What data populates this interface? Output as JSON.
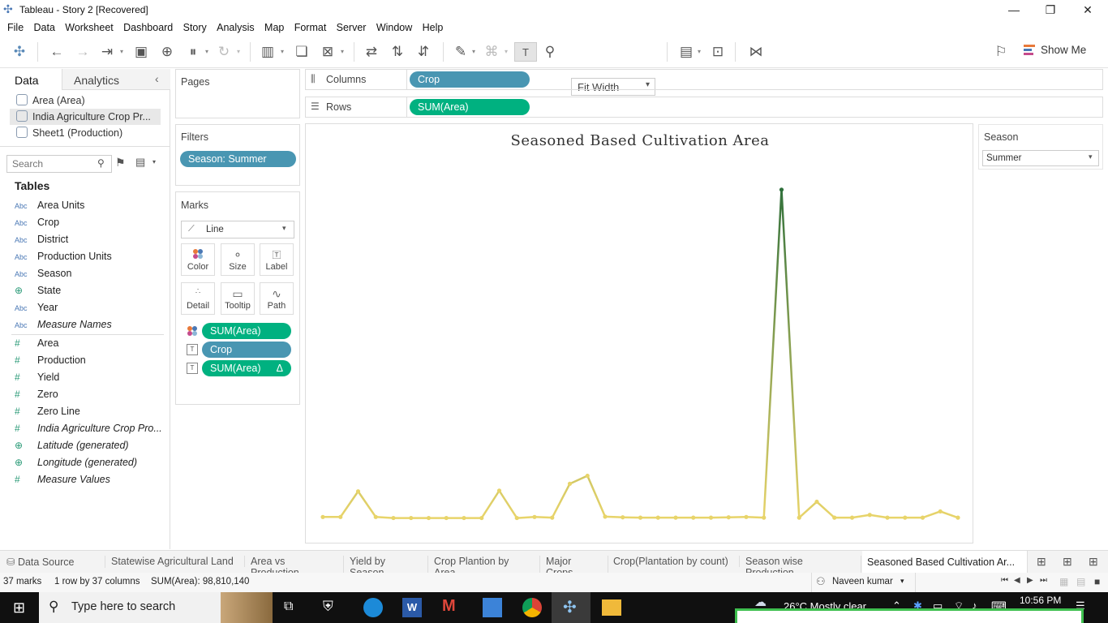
{
  "window": {
    "title": "Tableau - Story 2 [Recovered]"
  },
  "menu": [
    "File",
    "Data",
    "Worksheet",
    "Dashboard",
    "Story",
    "Analysis",
    "Map",
    "Format",
    "Server",
    "Window",
    "Help"
  ],
  "toolbar": {
    "fit_label": "Fit Width",
    "show_me_label": "Show Me"
  },
  "left_panel": {
    "tab_data": "Data",
    "tab_analytics": "Analytics",
    "data_sources": [
      "Area (Area)",
      "India Agriculture Crop Pr...",
      "Sheet1 (Production)"
    ],
    "search_placeholder": "Search",
    "tables_heading": "Tables",
    "dimensions": [
      {
        "type": "Abc",
        "name": "Area Units"
      },
      {
        "type": "Abc",
        "name": "Crop"
      },
      {
        "type": "Abc",
        "name": "District"
      },
      {
        "type": "Abc",
        "name": "Production Units"
      },
      {
        "type": "Abc",
        "name": "Season"
      },
      {
        "type": "globe",
        "name": "State"
      },
      {
        "type": "Abc",
        "name": "Year"
      },
      {
        "type": "Abc",
        "name": "Measure Names"
      }
    ],
    "measures": [
      {
        "type": "#",
        "name": "Area"
      },
      {
        "type": "#",
        "name": "Production"
      },
      {
        "type": "#",
        "name": "Yield"
      },
      {
        "type": "#",
        "name": "Zero"
      },
      {
        "type": "#",
        "name": "Zero Line"
      },
      {
        "type": "#",
        "name": "India Agriculture Crop Pro..."
      },
      {
        "type": "globe",
        "name": "Latitude (generated)"
      },
      {
        "type": "globe",
        "name": "Longitude (generated)"
      },
      {
        "type": "#",
        "name": "Measure Values"
      }
    ]
  },
  "pages": {
    "title": "Pages"
  },
  "filters": {
    "title": "Filters",
    "pill": "Season: Summer"
  },
  "marks": {
    "title": "Marks",
    "type": "Line",
    "buttons": [
      "Color",
      "Size",
      "Label",
      "Detail",
      "Tooltip",
      "Path"
    ],
    "pills": [
      "SUM(Area)",
      "Crop",
      "SUM(Area)"
    ],
    "delta_symbol": "Δ"
  },
  "shelves": {
    "columns_label": "Columns",
    "columns_pill": "Crop",
    "rows_label": "Rows",
    "rows_pill": "SUM(Area)"
  },
  "season_filter": {
    "title": "Season",
    "value": "Summer"
  },
  "chart_data": {
    "type": "line",
    "title": "Seasoned Based Cultivation Area",
    "xlabel": "",
    "ylabel": "",
    "grid": false,
    "values": [
      400,
      400,
      7800,
      400,
      100,
      100,
      100,
      100,
      100,
      100,
      8000,
      100,
      400,
      200,
      10000,
      12300,
      500,
      300,
      200,
      200,
      200,
      200,
      200,
      300,
      400,
      200,
      95000,
      200,
      4800,
      200,
      200,
      1000,
      200,
      200,
      200,
      2000,
      200
    ],
    "ylim": [
      0,
      98000
    ],
    "colors": {
      "low": "#e8d46a",
      "high": "#2e6f3b"
    }
  },
  "sheet_tabs": {
    "data_source": "Data Source",
    "tabs": [
      "Statewise Agricultural Land",
      "Area vs Production",
      "Yield by Season",
      "Crop Plantion by Area",
      "Major Crops",
      "Crop(Plantation by count)",
      "Season wise Production",
      "Seasoned Based Cultivation Ar..."
    ]
  },
  "status": {
    "marks": "37 marks",
    "rows_cols": "1 row by 37 columns",
    "sum": "SUM(Area): 98,810,140",
    "user": "Naveen kumar"
  },
  "taskbar": {
    "search_placeholder": "Type here to search",
    "weather": "26°C  Mostly clear",
    "time": "10:56 PM"
  }
}
